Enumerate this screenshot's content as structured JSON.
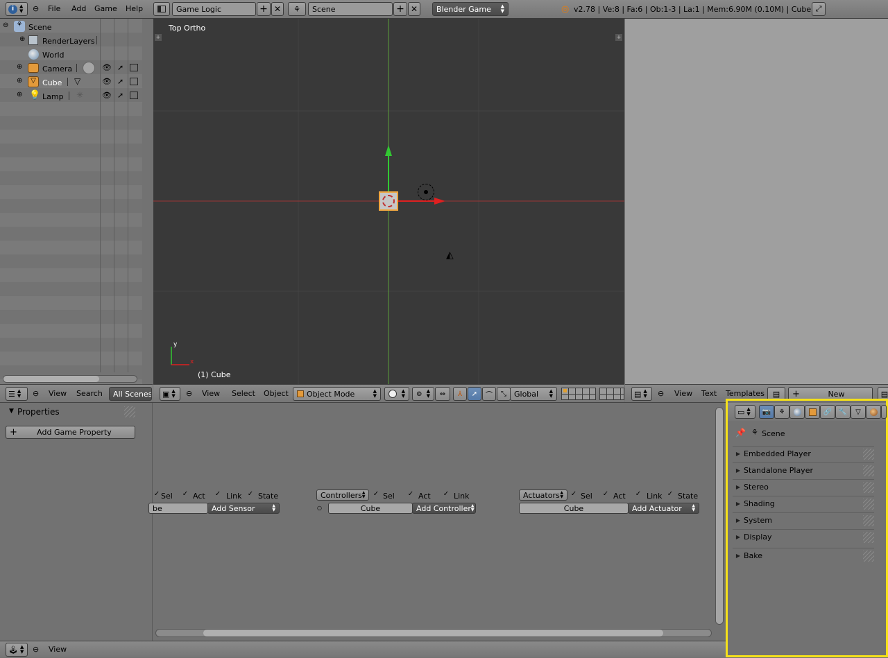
{
  "top_header": {
    "menus": [
      "File",
      "Add",
      "Game",
      "Help"
    ],
    "screen_layout": "Game Logic",
    "scene": "Scene",
    "engine": "Blender Game",
    "stats": "v2.78 | Ve:8 | Fa:6 | Ob:1-3 | La:1 | Mem:6.90M (0.10M) | Cube"
  },
  "outliner": {
    "items": [
      {
        "label": "Scene"
      },
      {
        "label": "RenderLayers"
      },
      {
        "label": "World"
      },
      {
        "label": "Camera"
      },
      {
        "label": "Cube"
      },
      {
        "label": "Lamp"
      }
    ],
    "footer": {
      "view": "View",
      "search": "Search",
      "filter": "All Scenes"
    }
  },
  "viewport": {
    "title": "Top Ortho",
    "object_label": "(1) Cube",
    "axis_y": "y",
    "axis_x": "x",
    "footer": {
      "view": "View",
      "select": "Select",
      "object": "Object",
      "mode": "Object Mode",
      "orientation": "Global"
    }
  },
  "text_editor": {
    "footer": {
      "view": "View",
      "text": "Text",
      "templates": "Templates",
      "new": "New"
    }
  },
  "logic_editor": {
    "properties_title": "Properties",
    "add_property": "Add Game Property",
    "sensors": {
      "sel": "Sel",
      "act": "Act",
      "link": "Link",
      "state": "State",
      "object": "be",
      "add": "Add Sensor"
    },
    "controllers": {
      "menu": "Controllers",
      "sel": "Sel",
      "act": "Act",
      "link": "Link",
      "object": "Cube",
      "add": "Add Controller"
    },
    "actuators": {
      "menu": "Actuators",
      "sel": "Sel",
      "act": "Act",
      "link": "Link",
      "state": "State",
      "object": "Cube",
      "add": "Add Actuator"
    },
    "footer": {
      "view": "View"
    }
  },
  "properties_editor": {
    "context": "Scene",
    "panels": [
      "Embedded Player",
      "Standalone Player",
      "Stereo",
      "Shading",
      "System",
      "Display",
      "Bake"
    ],
    "highlight_color": "#f5e11a"
  }
}
